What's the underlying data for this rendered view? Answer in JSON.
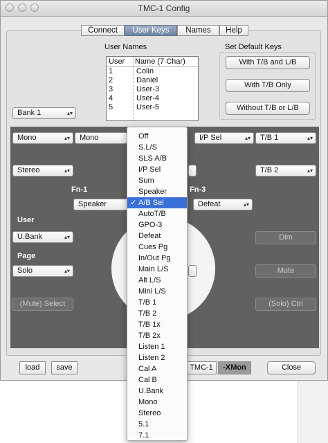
{
  "window": {
    "title": "TMC-1 Config"
  },
  "tabs": [
    {
      "label": "Connect",
      "selected": false
    },
    {
      "label": "User Keys",
      "selected": true
    },
    {
      "label": "Names",
      "selected": false
    },
    {
      "label": "Help",
      "selected": false
    }
  ],
  "user_names": {
    "section_label": "User Names",
    "columns": [
      "User",
      "Name (7 Char)"
    ],
    "rows": [
      {
        "user": "1",
        "name": "Colin"
      },
      {
        "user": "2",
        "name": "Daniel"
      },
      {
        "user": "3",
        "name": "User-3"
      },
      {
        "user": "4",
        "name": "User-4"
      },
      {
        "user": "5",
        "name": "User-5"
      }
    ]
  },
  "default_keys": {
    "section_label": "Set Default Keys",
    "buttons": [
      "With T/B and L/B",
      "With T/B Only",
      "Without T/B or L/B"
    ]
  },
  "bank_select": "Bank 1",
  "row1": [
    "Mono",
    "Mono",
    "I/P Sel",
    "T/B 1"
  ],
  "row2": [
    "Stereo",
    "T/B 2"
  ],
  "fn": {
    "fn1_label": "Fn-1",
    "fn3_label": "Fn-3",
    "fn1_value": "Speaker",
    "fn3_value": "Defeat"
  },
  "user_section": {
    "label": "User",
    "value": "U.Bank"
  },
  "page_section": {
    "label": "Page",
    "value": "Solo"
  },
  "right_buttons": {
    "dim": "Dim",
    "mute": "Mute",
    "solo_ctrl": "(Solo) Ctrl"
  },
  "mute_select": "(Mute) Select",
  "bottom": {
    "load": "load",
    "save": "save",
    "tmc": "TMC-1",
    "xmon": "-XMon",
    "close": "Close"
  },
  "menu": {
    "items": [
      "Off",
      "S.L/S",
      "SLS A/B",
      "I/P Sel",
      "Sum",
      "Speaker",
      "A/B Sel",
      "AutoT/B",
      "GPO-3",
      "Defeat",
      "Cues Pg",
      "In/Out Pg",
      "Main L/S",
      "Alt L/S",
      "Mini L/S",
      "T/B 1",
      "T/B 2",
      "T/B 1x",
      "T/B 2x",
      "Listen 1",
      "Listen 2",
      "Cal A",
      "Cal B",
      "U.Bank",
      "Mono",
      "Stereo",
      "5.1",
      "7.1"
    ],
    "selected": "A/B Sel",
    "check": "✓"
  },
  "colors": {
    "selection": "#3a6fd8",
    "dark_panel": "#616161",
    "tab_selected": "#7d92ae"
  }
}
